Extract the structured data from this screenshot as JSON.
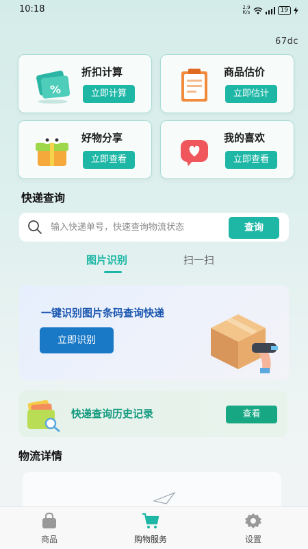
{
  "status": {
    "time": "10:18",
    "net_speed_top": "2.9",
    "net_speed_bottom": "K/s",
    "battery": "19"
  },
  "code_label": "67dc",
  "cards": [
    {
      "title": "折扣计算",
      "button": "立即计算",
      "icon": "discount-coupon-icon"
    },
    {
      "title": "商品估价",
      "button": "立即估计",
      "icon": "clipboard-icon"
    },
    {
      "title": "好物分享",
      "button": "立即查看",
      "icon": "gift-box-icon"
    },
    {
      "title": "我的喜欢",
      "button": "立即查看",
      "icon": "heart-icon"
    }
  ],
  "express": {
    "title": "快递查询",
    "placeholder": "输入快递单号，快速查询物流状态",
    "search_button": "查询"
  },
  "tabs": [
    {
      "label": "图片识别",
      "active": true
    },
    {
      "label": "扫一扫",
      "active": false
    }
  ],
  "scan_banner": {
    "title": "一键识别图片条码查询快递",
    "button": "立即识别"
  },
  "history": {
    "title": "快递查询历史记录",
    "button": "查看"
  },
  "logistics": {
    "title": "物流详情"
  },
  "bottom_nav": [
    {
      "label": "商品",
      "icon": "shopping-bag-icon",
      "active": false
    },
    {
      "label": "购物服务",
      "icon": "shopping-cart-icon",
      "active": true
    },
    {
      "label": "设置",
      "icon": "gear-icon",
      "active": false
    }
  ],
  "colors": {
    "accent": "#1eb7a6",
    "scan_blue": "#1a79c6",
    "history_green": "#17a783"
  }
}
